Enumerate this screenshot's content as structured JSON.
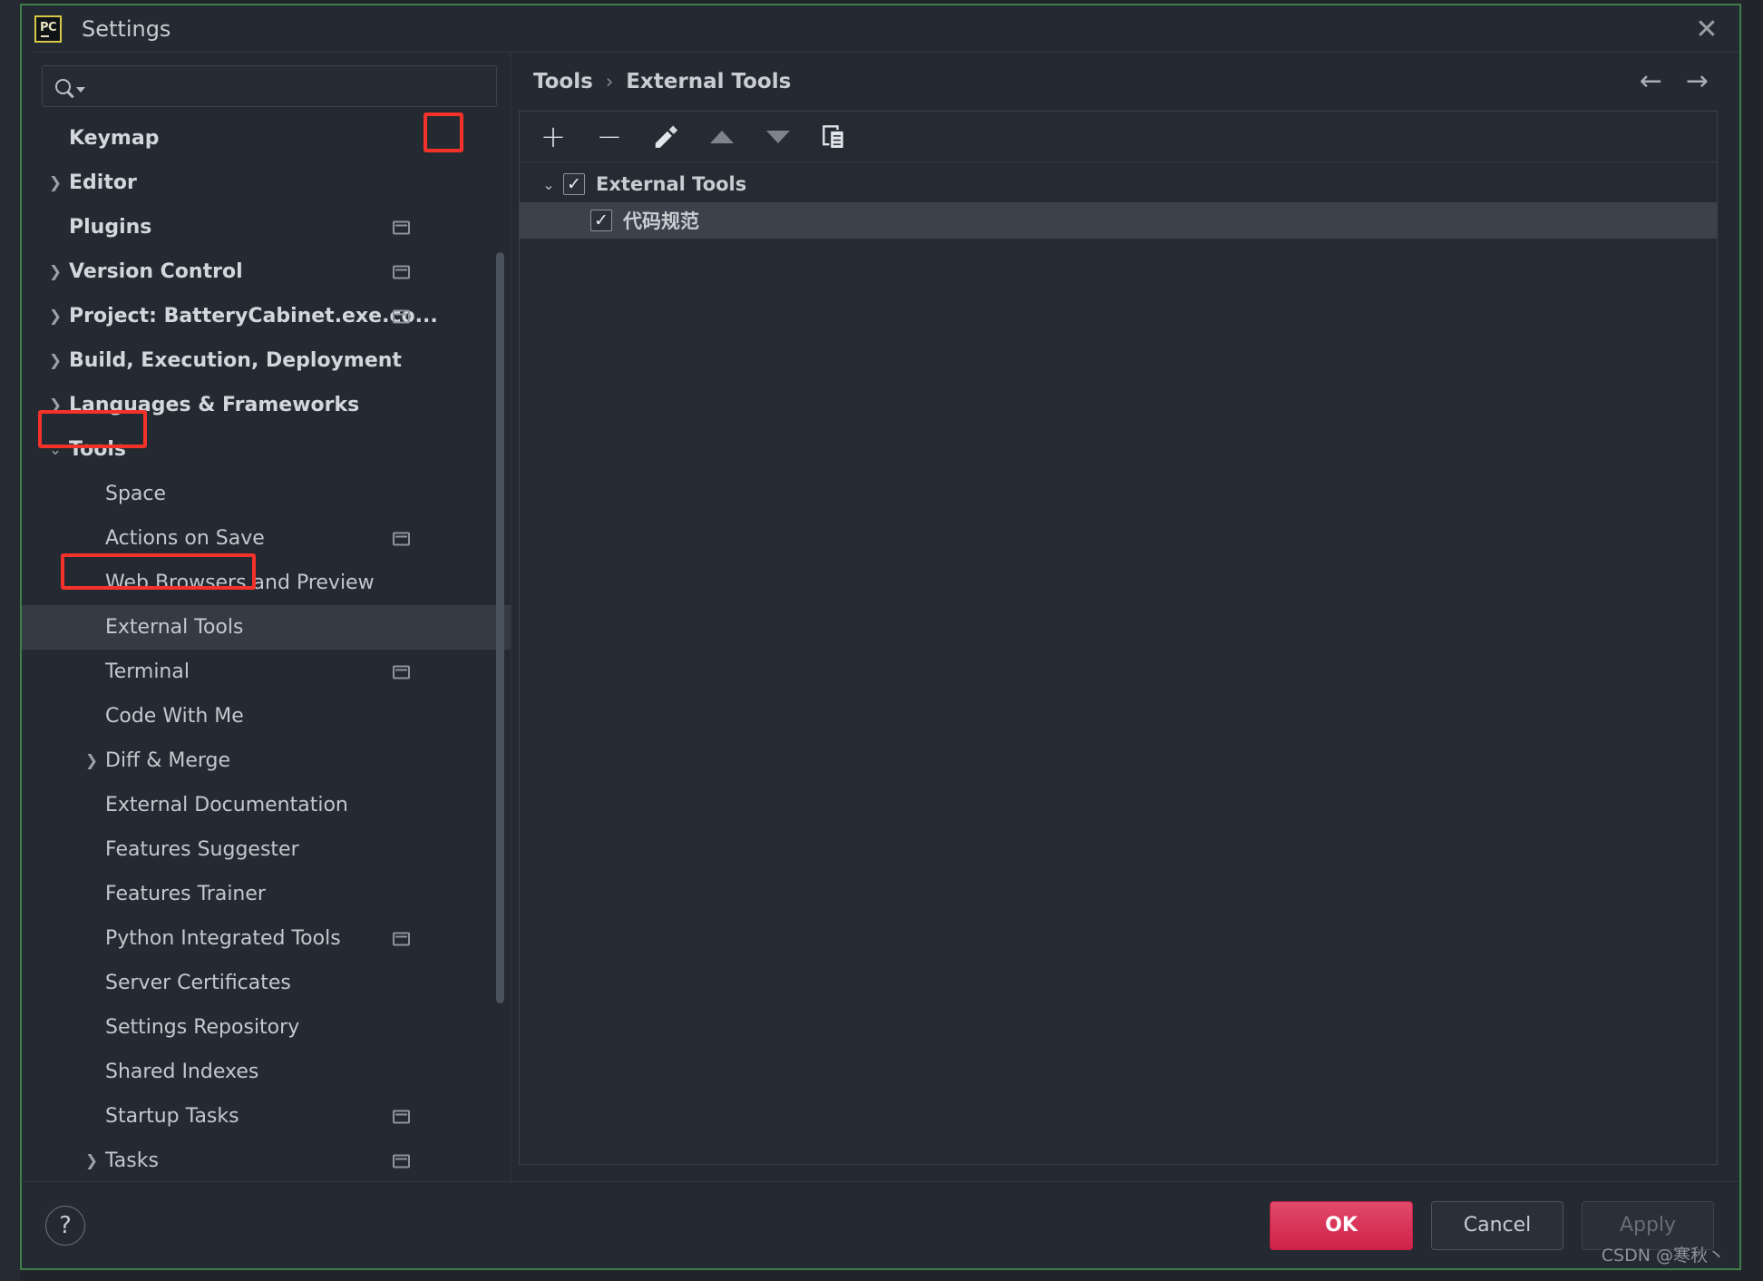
{
  "window": {
    "title": "Settings",
    "app_icon": "pycharm-icon",
    "app_icon_text": "PC",
    "close_icon": "close-icon"
  },
  "search": {
    "value": "",
    "placeholder": "",
    "icon": "search-icon"
  },
  "sidebar": {
    "items": [
      {
        "label": "Keymap",
        "level": "top",
        "arrow": "",
        "indicator": false
      },
      {
        "label": "Editor",
        "level": "top",
        "arrow": "right",
        "indicator": false
      },
      {
        "label": "Plugins",
        "level": "top",
        "arrow": "",
        "indicator": true
      },
      {
        "label": "Version Control",
        "level": "top",
        "arrow": "right",
        "indicator": true
      },
      {
        "label": "Project: BatteryCabinet.exe.co...",
        "level": "top",
        "arrow": "right",
        "indicator": true
      },
      {
        "label": "Build, Execution, Deployment",
        "level": "top",
        "arrow": "right",
        "indicator": false
      },
      {
        "label": "Languages & Frameworks",
        "level": "top",
        "arrow": "right",
        "indicator": false
      },
      {
        "label": "Tools",
        "level": "top",
        "arrow": "down",
        "indicator": false,
        "highlighted": true
      },
      {
        "label": "Space",
        "level": "child",
        "arrow": "",
        "indicator": false
      },
      {
        "label": "Actions on Save",
        "level": "child",
        "arrow": "",
        "indicator": true
      },
      {
        "label": "Web Browsers and Preview",
        "level": "child",
        "arrow": "",
        "indicator": false
      },
      {
        "label": "External Tools",
        "level": "child",
        "arrow": "",
        "indicator": false,
        "selected": true,
        "highlighted": true
      },
      {
        "label": "Terminal",
        "level": "child",
        "arrow": "",
        "indicator": true
      },
      {
        "label": "Code With Me",
        "level": "child",
        "arrow": "",
        "indicator": false
      },
      {
        "label": "Diff & Merge",
        "level": "child",
        "arrow": "right",
        "indicator": false
      },
      {
        "label": "External Documentation",
        "level": "child",
        "arrow": "",
        "indicator": false
      },
      {
        "label": "Features Suggester",
        "level": "child",
        "arrow": "",
        "indicator": false
      },
      {
        "label": "Features Trainer",
        "level": "child",
        "arrow": "",
        "indicator": false
      },
      {
        "label": "Python Integrated Tools",
        "level": "child",
        "arrow": "",
        "indicator": true
      },
      {
        "label": "Server Certificates",
        "level": "child",
        "arrow": "",
        "indicator": false
      },
      {
        "label": "Settings Repository",
        "level": "child",
        "arrow": "",
        "indicator": false
      },
      {
        "label": "Shared Indexes",
        "level": "child",
        "arrow": "",
        "indicator": false
      },
      {
        "label": "Startup Tasks",
        "level": "child",
        "arrow": "",
        "indicator": true
      },
      {
        "label": "Tasks",
        "level": "child",
        "arrow": "right",
        "indicator": true
      }
    ]
  },
  "main": {
    "breadcrumb": {
      "parent": "Tools",
      "separator": "›",
      "current": "External Tools"
    },
    "nav": {
      "back_icon": "arrow-left-icon",
      "forward_icon": "arrow-right-icon",
      "back": "←",
      "forward": "→"
    },
    "toolbar": [
      {
        "name": "add-button",
        "icon": "plus-icon",
        "glyph": "+",
        "highlighted": true
      },
      {
        "name": "remove-button",
        "icon": "minus-icon",
        "glyph": "−",
        "highlighted": false
      },
      {
        "name": "edit-button",
        "icon": "pencil-icon",
        "glyph": "",
        "highlighted": false
      },
      {
        "name": "move-up-button",
        "icon": "caret-up-icon",
        "glyph": "",
        "highlighted": false
      },
      {
        "name": "move-down-button",
        "icon": "caret-down-icon",
        "glyph": "",
        "highlighted": false
      },
      {
        "name": "copy-button",
        "icon": "copy-icon",
        "glyph": "",
        "highlighted": false
      }
    ],
    "tree": [
      {
        "label": "External Tools",
        "arrow": "down",
        "checked": true,
        "check_glyph": "✓",
        "selected": false,
        "indent": 0
      },
      {
        "label": "代码规范",
        "arrow": "",
        "checked": true,
        "check_glyph": "✓",
        "selected": true,
        "indent": 1
      }
    ]
  },
  "footer": {
    "help_icon": "question-mark-icon",
    "help_label": "?",
    "ok_label": "OK",
    "cancel_label": "Cancel",
    "apply_label": "Apply",
    "watermark": "CSDN @寒秋丶"
  },
  "colors": {
    "accent_ok": "#d42a4d",
    "annotation_red": "#f5322a",
    "frame_green": "#3f7d4a",
    "panel_bg": "#252b33",
    "dialog_bg": "#242a31",
    "selected_row": "#343b45"
  }
}
